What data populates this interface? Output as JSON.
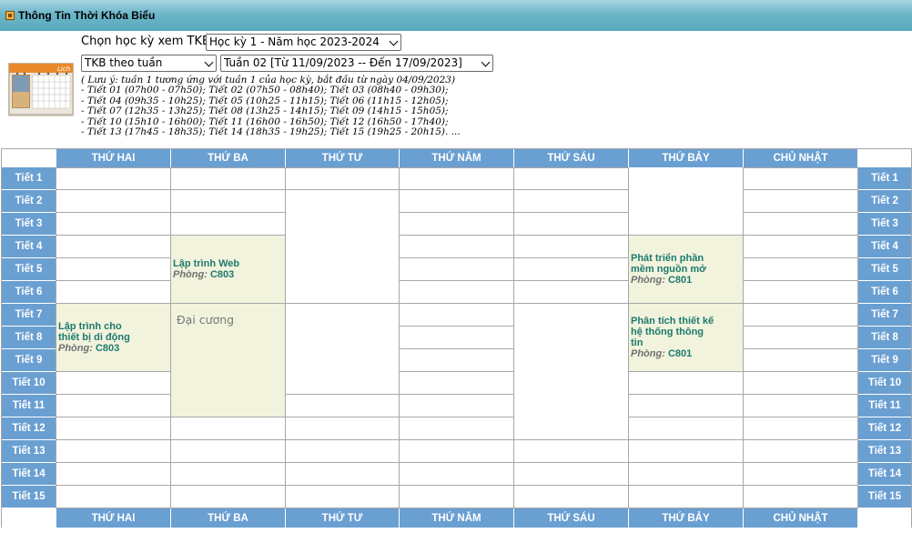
{
  "window": {
    "title": "Thông Tin Thời Khóa Biểu",
    "title_icon": "window-icon"
  },
  "controls": {
    "semester_label": "Chọn học kỳ xem TKB",
    "semester_value": "Học kỳ 1 - Năm học 2023-2024",
    "mode_value": "TKB theo tuần",
    "week_value": "Tuần 02 [Từ 11/09/2023 -- Đến 17/09/2023]",
    "calendar_icon_label": "Lịch"
  },
  "notes": [
    "( Lưu ý: tuần 1 tương ứng với tuần 1 của học kỳ, bắt đầu từ ngày 04/09/2023)",
    "- Tiết 01 (07h00 - 07h50); Tiết 02 (07h50 - 08h40); Tiết 03 (08h40 - 09h30);",
    "- Tiết 04 (09h35 - 10h25); Tiết 05 (10h25 - 11h15); Tiết 06 (11h15 - 12h05);",
    "- Tiết 07 (12h35 - 13h25); Tiết 08 (13h25 - 14h15); Tiết 09 (14h15 - 15h05);",
    "- Tiết 10 (15h10 - 16h00); Tiết 11 (16h00 - 16h50); Tiết 12 (16h50 - 17h40);",
    "- Tiết 13 (17h45 - 18h35); Tiết 14 (18h35 - 19h25); Tiết 15 (19h25 - 20h15). ..."
  ],
  "days": [
    "THỨ HAI",
    "THỨ BA",
    "THỨ TƯ",
    "THỨ NĂM",
    "THỨ SÁU",
    "THỨ BẢY",
    "CHỦ NHẬT"
  ],
  "periods": [
    "Tiết 1",
    "Tiết 2",
    "Tiết 3",
    "Tiết 4",
    "Tiết 5",
    "Tiết 6",
    "Tiết 7",
    "Tiết 8",
    "Tiết 9",
    "Tiết 10",
    "Tiết 11",
    "Tiết 12",
    "Tiết 13",
    "Tiết 14",
    "Tiết 15"
  ],
  "room_label": "Phòng:",
  "classes": [
    {
      "name": "Lập trình cho thiết bị di động",
      "name_lines": [
        "Lập trình cho",
        "thiết bị di động"
      ],
      "room": "C803",
      "day": "THỨ HAI",
      "period_start": 7,
      "period_end": 9
    },
    {
      "name": "Lập trình Web",
      "name_lines": [
        "Lập trình Web"
      ],
      "room": "C803",
      "day": "THỨ BA",
      "period_start": 4,
      "period_end": 6
    },
    {
      "name": "Đại cương",
      "name_lines": [
        "Đại cương"
      ],
      "room": "",
      "day": "THỨ BA",
      "period_start": 7,
      "period_end": 11
    },
    {
      "name": "Phát triển phần mềm nguồn mở",
      "name_lines": [
        "Phát triển phần",
        "mềm nguồn mở"
      ],
      "room": "C801",
      "day": "THỨ BẢY",
      "period_start": 4,
      "period_end": 6
    },
    {
      "name": "Phân tích thiết kế hệ thống thông tin",
      "name_lines": [
        "Phân tích thiết kế",
        "hệ thống thông",
        "tin"
      ],
      "room": "C801",
      "day": "THỨ BẢY",
      "period_start": 7,
      "period_end": 9
    }
  ],
  "colors": {
    "header_blue": "#6a9fd2",
    "class_bg": "#f2f3dd",
    "class_text": "#1c7a6c",
    "titlebar": "#6cb6c9"
  }
}
